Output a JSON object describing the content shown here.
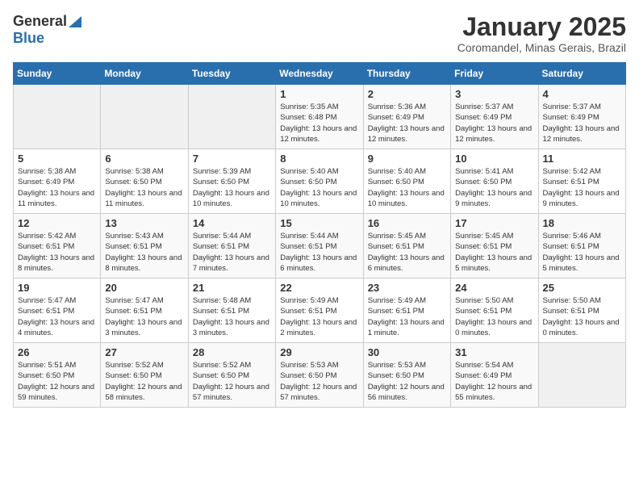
{
  "logo": {
    "general": "General",
    "blue": "Blue"
  },
  "title": "January 2025",
  "subtitle": "Coromandel, Minas Gerais, Brazil",
  "days_of_week": [
    "Sunday",
    "Monday",
    "Tuesday",
    "Wednesday",
    "Thursday",
    "Friday",
    "Saturday"
  ],
  "weeks": [
    [
      {
        "day": "",
        "info": ""
      },
      {
        "day": "",
        "info": ""
      },
      {
        "day": "",
        "info": ""
      },
      {
        "day": "1",
        "info": "Sunrise: 5:35 AM\nSunset: 6:48 PM\nDaylight: 13 hours and 12 minutes."
      },
      {
        "day": "2",
        "info": "Sunrise: 5:36 AM\nSunset: 6:49 PM\nDaylight: 13 hours and 12 minutes."
      },
      {
        "day": "3",
        "info": "Sunrise: 5:37 AM\nSunset: 6:49 PM\nDaylight: 13 hours and 12 minutes."
      },
      {
        "day": "4",
        "info": "Sunrise: 5:37 AM\nSunset: 6:49 PM\nDaylight: 13 hours and 12 minutes."
      }
    ],
    [
      {
        "day": "5",
        "info": "Sunrise: 5:38 AM\nSunset: 6:49 PM\nDaylight: 13 hours and 11 minutes."
      },
      {
        "day": "6",
        "info": "Sunrise: 5:38 AM\nSunset: 6:50 PM\nDaylight: 13 hours and 11 minutes."
      },
      {
        "day": "7",
        "info": "Sunrise: 5:39 AM\nSunset: 6:50 PM\nDaylight: 13 hours and 10 minutes."
      },
      {
        "day": "8",
        "info": "Sunrise: 5:40 AM\nSunset: 6:50 PM\nDaylight: 13 hours and 10 minutes."
      },
      {
        "day": "9",
        "info": "Sunrise: 5:40 AM\nSunset: 6:50 PM\nDaylight: 13 hours and 10 minutes."
      },
      {
        "day": "10",
        "info": "Sunrise: 5:41 AM\nSunset: 6:50 PM\nDaylight: 13 hours and 9 minutes."
      },
      {
        "day": "11",
        "info": "Sunrise: 5:42 AM\nSunset: 6:51 PM\nDaylight: 13 hours and 9 minutes."
      }
    ],
    [
      {
        "day": "12",
        "info": "Sunrise: 5:42 AM\nSunset: 6:51 PM\nDaylight: 13 hours and 8 minutes."
      },
      {
        "day": "13",
        "info": "Sunrise: 5:43 AM\nSunset: 6:51 PM\nDaylight: 13 hours and 8 minutes."
      },
      {
        "day": "14",
        "info": "Sunrise: 5:44 AM\nSunset: 6:51 PM\nDaylight: 13 hours and 7 minutes."
      },
      {
        "day": "15",
        "info": "Sunrise: 5:44 AM\nSunset: 6:51 PM\nDaylight: 13 hours and 6 minutes."
      },
      {
        "day": "16",
        "info": "Sunrise: 5:45 AM\nSunset: 6:51 PM\nDaylight: 13 hours and 6 minutes."
      },
      {
        "day": "17",
        "info": "Sunrise: 5:45 AM\nSunset: 6:51 PM\nDaylight: 13 hours and 5 minutes."
      },
      {
        "day": "18",
        "info": "Sunrise: 5:46 AM\nSunset: 6:51 PM\nDaylight: 13 hours and 5 minutes."
      }
    ],
    [
      {
        "day": "19",
        "info": "Sunrise: 5:47 AM\nSunset: 6:51 PM\nDaylight: 13 hours and 4 minutes."
      },
      {
        "day": "20",
        "info": "Sunrise: 5:47 AM\nSunset: 6:51 PM\nDaylight: 13 hours and 3 minutes."
      },
      {
        "day": "21",
        "info": "Sunrise: 5:48 AM\nSunset: 6:51 PM\nDaylight: 13 hours and 3 minutes."
      },
      {
        "day": "22",
        "info": "Sunrise: 5:49 AM\nSunset: 6:51 PM\nDaylight: 13 hours and 2 minutes."
      },
      {
        "day": "23",
        "info": "Sunrise: 5:49 AM\nSunset: 6:51 PM\nDaylight: 13 hours and 1 minute."
      },
      {
        "day": "24",
        "info": "Sunrise: 5:50 AM\nSunset: 6:51 PM\nDaylight: 13 hours and 0 minutes."
      },
      {
        "day": "25",
        "info": "Sunrise: 5:50 AM\nSunset: 6:51 PM\nDaylight: 13 hours and 0 minutes."
      }
    ],
    [
      {
        "day": "26",
        "info": "Sunrise: 5:51 AM\nSunset: 6:50 PM\nDaylight: 12 hours and 59 minutes."
      },
      {
        "day": "27",
        "info": "Sunrise: 5:52 AM\nSunset: 6:50 PM\nDaylight: 12 hours and 58 minutes."
      },
      {
        "day": "28",
        "info": "Sunrise: 5:52 AM\nSunset: 6:50 PM\nDaylight: 12 hours and 57 minutes."
      },
      {
        "day": "29",
        "info": "Sunrise: 5:53 AM\nSunset: 6:50 PM\nDaylight: 12 hours and 57 minutes."
      },
      {
        "day": "30",
        "info": "Sunrise: 5:53 AM\nSunset: 6:50 PM\nDaylight: 12 hours and 56 minutes."
      },
      {
        "day": "31",
        "info": "Sunrise: 5:54 AM\nSunset: 6:49 PM\nDaylight: 12 hours and 55 minutes."
      },
      {
        "day": "",
        "info": ""
      }
    ]
  ]
}
